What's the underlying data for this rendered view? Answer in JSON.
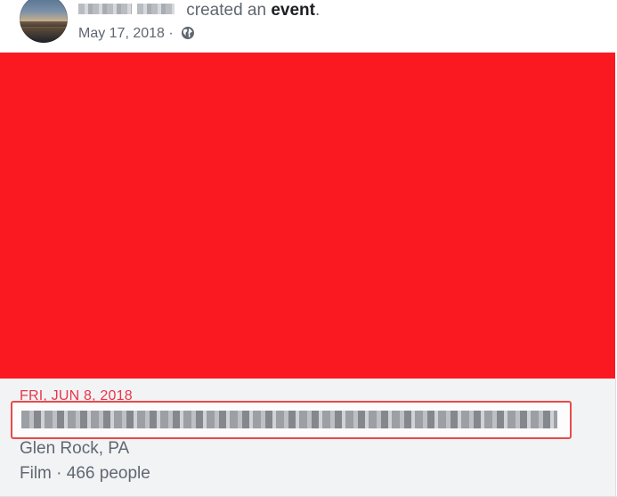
{
  "post": {
    "action_text": " created an ",
    "action_emphasis": "event",
    "action_end": ".",
    "date": "May 17, 2018",
    "separator": " · ",
    "privacy_icon": "globe-icon"
  },
  "event": {
    "cover_color": "#fa1921",
    "date": "FRI, JUN 8, 2018",
    "location": "Glen Rock, PA",
    "category": "Film",
    "attendance": "466 people",
    "meta_separator": " · "
  },
  "colors": {
    "accent": "#e8364a",
    "highlight_border": "#e84a4a",
    "secondary_text": "#606770"
  }
}
